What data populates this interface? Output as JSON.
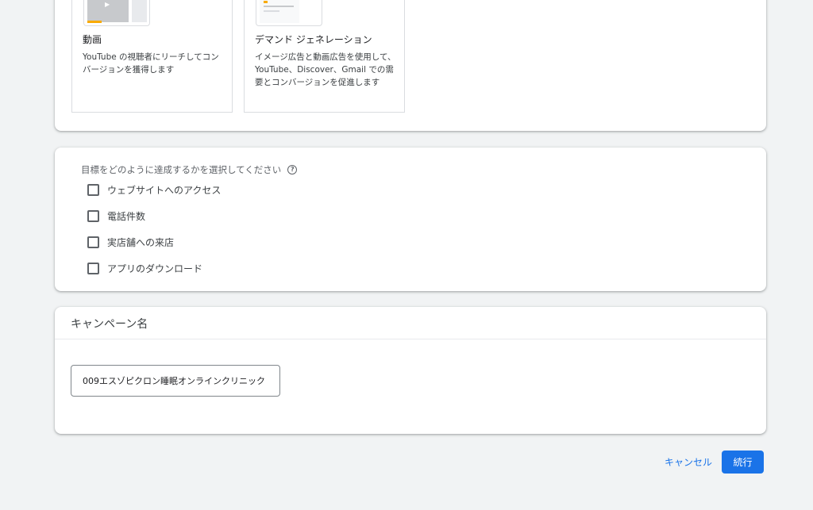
{
  "campaign_types": [
    {
      "title": "動画",
      "description": "YouTube の視聴者にリーチしてコンバージョンを獲得します"
    },
    {
      "title": "デマンド ジェネレーション",
      "description": "イメージ広告と動画広告を使用して、YouTube、Discover、Gmail での需要とコンバージョンを促進します"
    }
  ],
  "goals": {
    "heading": "目標をどのように達成するかを選択してください",
    "help_icon": "?",
    "options": [
      {
        "label": "ウェブサイトへのアクセス",
        "checked": false
      },
      {
        "label": "電話件数",
        "checked": false
      },
      {
        "label": "実店舗への来店",
        "checked": false
      },
      {
        "label": "アプリのダウンロード",
        "checked": false
      }
    ]
  },
  "campaign_name": {
    "title": "キャンペーン名",
    "value": "009エスゾピクロン睡眠オンラインクリニック"
  },
  "footer": {
    "cancel_label": "キャンセル",
    "continue_label": "続行"
  },
  "colors": {
    "accent": "#1a73e8",
    "background": "#f1f3f4"
  }
}
